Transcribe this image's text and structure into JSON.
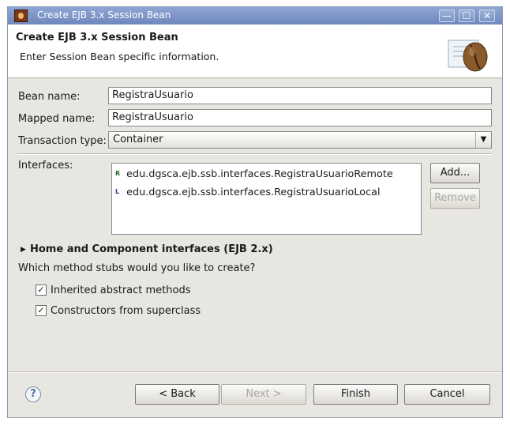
{
  "window": {
    "title": "Create EJB 3.x Session Bean",
    "controls": {
      "minimize": "—",
      "maximize": "☐",
      "close": "✕"
    }
  },
  "header": {
    "title": "Create EJB 3.x Session Bean",
    "description": "Enter Session Bean specific information.",
    "icon": "coffee-bean-icon"
  },
  "form": {
    "bean_name_label": "Bean name:",
    "bean_name_value": "RegistraUsuario",
    "mapped_name_label": "Mapped name:",
    "mapped_name_value": "RegistraUsuario",
    "transaction_type_label": "Transaction type:",
    "transaction_type_value": "Container",
    "interfaces_label": "Interfaces:",
    "interfaces": [
      {
        "marker": "R",
        "name": "edu.dgsca.ejb.ssb.interfaces.RegistraUsuarioRemote"
      },
      {
        "marker": "L",
        "name": "edu.dgsca.ejb.ssb.interfaces.RegistraUsuarioLocal"
      }
    ],
    "add_button": "Add...",
    "remove_button": "Remove",
    "home_section": "Home and Component interfaces (EJB 2.x)",
    "stubs_question": "Which method stubs would you like to create?",
    "stub_options": [
      {
        "label": "Inherited abstract methods",
        "checked": true
      },
      {
        "label": "Constructors from superclass",
        "checked": true
      }
    ]
  },
  "footer": {
    "help": "?",
    "back": "< Back",
    "next": "Next >",
    "finish": "Finish",
    "cancel": "Cancel"
  }
}
